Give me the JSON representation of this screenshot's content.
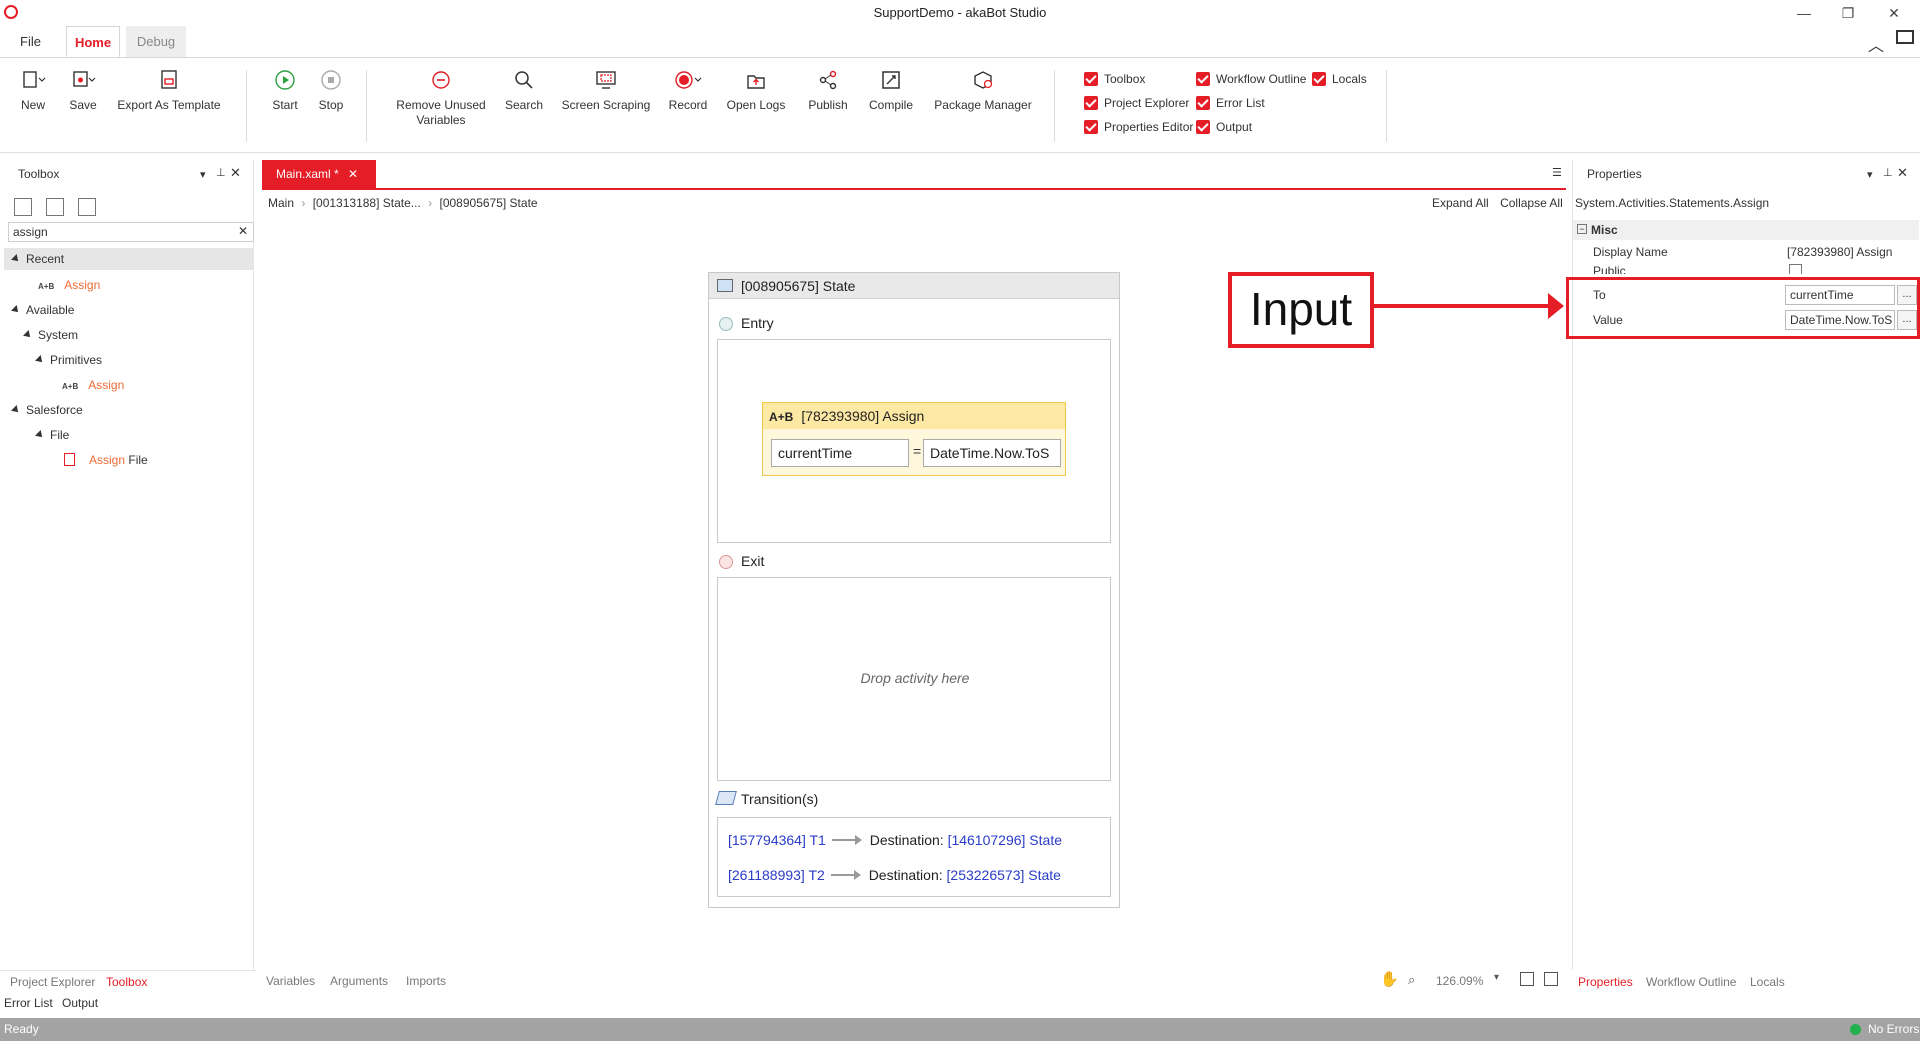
{
  "window": {
    "title": "SupportDemo - akaBot Studio",
    "minimize": "—",
    "restore": "❐",
    "close": "✕"
  },
  "menu_tabs": {
    "file": "File",
    "home": "Home",
    "debug": "Debug"
  },
  "ribbon": {
    "new": "New",
    "save": "Save",
    "export_as_template": "Export As Template",
    "start": "Start",
    "stop": "Stop",
    "remove_unused_1": "Remove Unused",
    "remove_unused_2": "Variables",
    "search": "Search",
    "screen_scraping": "Screen Scraping",
    "record": "Record",
    "open_logs": "Open Logs",
    "publish": "Publish",
    "compile": "Compile",
    "package_manager": "Package Manager"
  },
  "panel_toggles": {
    "toolbox": "Toolbox",
    "project_explorer": "Project Explorer",
    "properties_editor": "Properties Editor",
    "workflow_outline": "Workflow Outline",
    "error_list": "Error List",
    "output": "Output",
    "locals": "Locals"
  },
  "toolbox": {
    "title": "Toolbox",
    "search_value": "assign",
    "recent": "Recent",
    "available": "Available",
    "system": "System",
    "primitives": "Primitives",
    "salesforce": "Salesforce",
    "file": "File",
    "assign": "Assign",
    "assign_file_rest": " File",
    "ab_icon": "A+B"
  },
  "document": {
    "tab_label": "Main.xaml *",
    "breadcrumb": {
      "main": "Main",
      "sep": "›",
      "state1": "[001313188] State...",
      "state2": "[008905675] State"
    },
    "expand_all": "Expand All",
    "collapse_all": "Collapse All"
  },
  "state": {
    "title": "[008905675] State",
    "entry": "Entry",
    "exit": "Exit",
    "transitions": "Transition(s)",
    "drop_text": "Drop activity here",
    "assign_title": "[782393980] Assign",
    "assign_icon": "A+B",
    "assign_to": "currentTime",
    "assign_eq": "=",
    "assign_value": "DateTime.Now.ToS",
    "transition_rows": [
      {
        "name": "[157794364] T1",
        "dest_label": "Destination:",
        "dest": "[146107296] State"
      },
      {
        "name": "[261188993] T2",
        "dest_label": "Destination:",
        "dest": "[253226573] State"
      }
    ]
  },
  "annotation": {
    "label": "Input"
  },
  "properties": {
    "title": "Properties",
    "type_name": "System.Activities.Statements.Assign",
    "category": "Misc",
    "display_name_label": "Display Name",
    "display_name_value": "[782393980] Assign",
    "public_label": "Public",
    "to_label": "To",
    "to_value": "currentTime",
    "value_label": "Value",
    "value_value": "DateTime.Now.ToS",
    "dots": "..."
  },
  "bottom_tabs": {
    "project_explorer": "Project Explorer",
    "toolbox": "Toolbox",
    "error_list": "Error List",
    "output": "Output",
    "variables": "Variables",
    "arguments": "Arguments",
    "imports": "Imports",
    "zoom": "126.09%",
    "properties": "Properties",
    "workflow_outline": "Workflow Outline",
    "locals": "Locals"
  },
  "status": {
    "left": "Ready",
    "right": "No Errors"
  },
  "colors": {
    "accent": "#e41d26",
    "assign_bg": "#fde9a3",
    "link_blue": "#2a3cc8",
    "status_bar": "#a3a3a3",
    "ok_green": "#22b14c"
  }
}
